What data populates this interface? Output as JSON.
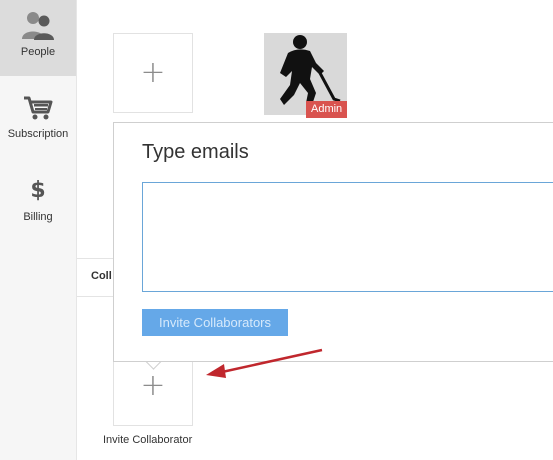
{
  "sidebar": {
    "items": [
      {
        "label": "People",
        "icon": "people-icon",
        "active": true
      },
      {
        "label": "Subscription",
        "icon": "cart-icon",
        "active": false
      },
      {
        "label": "Billing",
        "icon": "dollar-icon",
        "active": false
      }
    ]
  },
  "members": {
    "admin_badge": "Admin",
    "add_icon": "plus-icon"
  },
  "section": {
    "label": "Coll"
  },
  "invite_popover": {
    "title": "Type emails",
    "input_value": "",
    "button_label": "Invite Collaborators"
  },
  "invite_tile": {
    "caption": "Invite Collaborator",
    "icon": "plus-icon"
  },
  "annotation": {
    "arrow_color": "#c0272d"
  },
  "colors": {
    "accent": "#65a8e8",
    "admin_badge": "#d9534f",
    "active_nav": "#dcdcdc"
  }
}
